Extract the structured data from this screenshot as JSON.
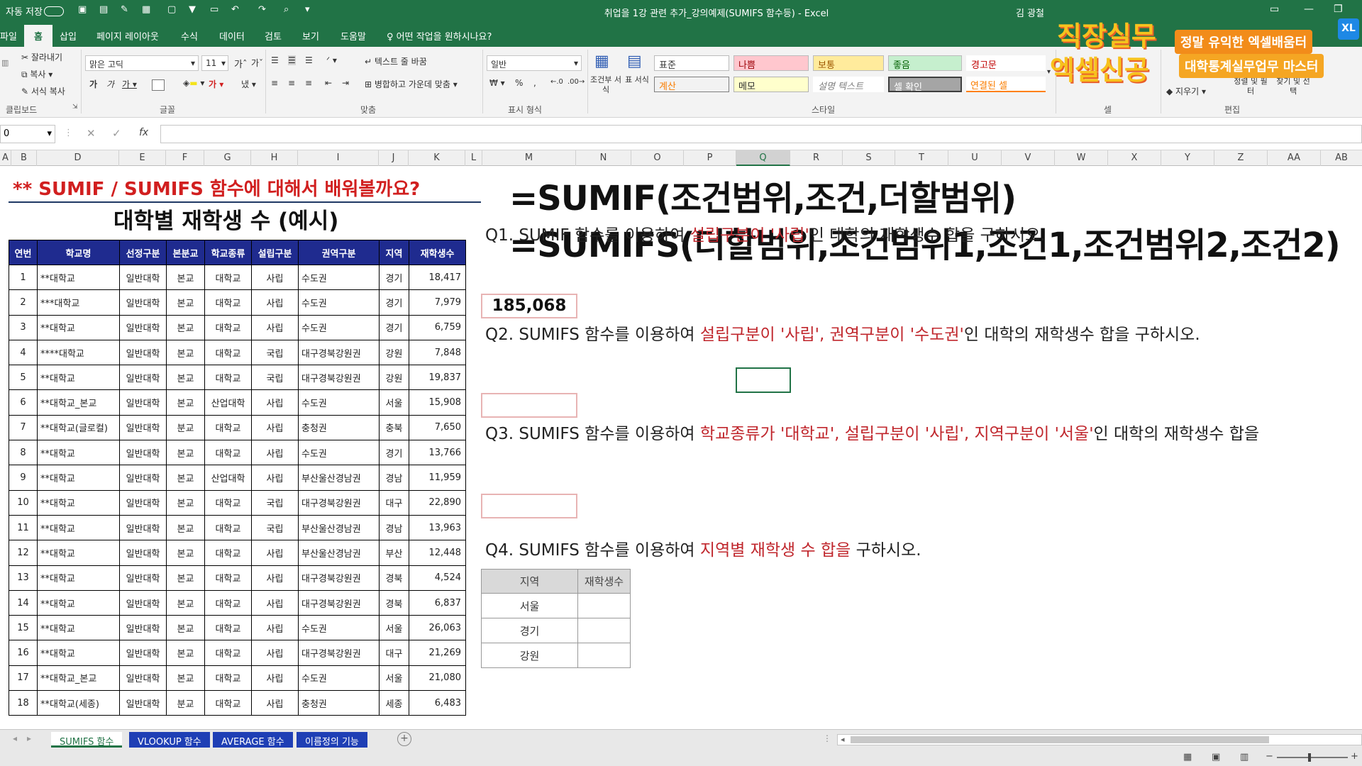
{
  "window": {
    "title": "취업을 1강 관련 추가_강의예제(SUMIFS 함수등) - Excel",
    "user": "김 광철",
    "autosave": "자동 저장"
  },
  "ribbon": {
    "tabs": [
      "파일",
      "홈",
      "삽입",
      "페이지 레이아웃",
      "수식",
      "데이터",
      "검토",
      "보기",
      "도움말"
    ],
    "active_tab": "홈",
    "tell_me": "어떤 작업을 원하시나요?",
    "clipboard": {
      "cut": "잘라내기",
      "copy": "복사",
      "format_painter": "서식 복사",
      "group": "클립보드"
    },
    "font": {
      "name": "맑은 고딕",
      "size": "11",
      "group": "글꼴"
    },
    "align": {
      "wrap": "텍스트 줄 바꿈",
      "merge": "병합하고 가운데 맞춤",
      "group": "맞춤"
    },
    "number": {
      "format": "일반",
      "group": "표시 형식"
    },
    "cond_format": "조건부 서식",
    "table_format": "표 서식",
    "styles": {
      "group": "스타일",
      "items": [
        "표준",
        "나쁨",
        "보통",
        "좋음",
        "경고문",
        "계산",
        "메모",
        "설명 텍스트",
        "셀 확인",
        "연결된 셀"
      ]
    },
    "cells_group": "셀",
    "editing": {
      "clear": "지우기",
      "sort": "정렬 및 필터",
      "find": "찾기 및 선택",
      "group": "편집"
    }
  },
  "formula_bar": {
    "name_box": "0",
    "fx": "fx"
  },
  "columns": [
    "A",
    "B",
    "D",
    "E",
    "F",
    "G",
    "H",
    "I",
    "J",
    "K",
    "L",
    "M",
    "N",
    "O",
    "P",
    "Q",
    "R",
    "S",
    "T",
    "U",
    "V",
    "W",
    "X",
    "Y",
    "Z",
    "AA",
    "AB"
  ],
  "logo": {
    "line1": "직장실무",
    "line2": "엑셀신공",
    "tag1": "정말 유익한 엑셀배움터",
    "tag2": "대학통계실무업무 마스터",
    "badge": "XL"
  },
  "sheet": {
    "heading": "** SUMIF / SUMIFS 함수에 대해서 배워볼까요?",
    "subtitle": "대학별 재학생 수 (예시)",
    "formula1": "=SUMIF(조건범위,조건,더할범위)",
    "formula2": "=SUMIFS(더할범위,조건범위1,조건1,조건범위2,조건2)",
    "table_headers": [
      "연번",
      "학교명",
      "선정구분",
      "본분교",
      "학교종류",
      "설립구분",
      "권역구분",
      "지역",
      "재학생수"
    ],
    "rows": [
      [
        "1",
        "**대학교",
        "일반대학",
        "본교",
        "대학교",
        "사립",
        "수도권",
        "경기",
        "18,417"
      ],
      [
        "2",
        "***대학교",
        "일반대학",
        "본교",
        "대학교",
        "사립",
        "수도권",
        "경기",
        "7,979"
      ],
      [
        "3",
        "**대학교",
        "일반대학",
        "본교",
        "대학교",
        "사립",
        "수도권",
        "경기",
        "6,759"
      ],
      [
        "4",
        "****대학교",
        "일반대학",
        "본교",
        "대학교",
        "국립",
        "대구경북강원권",
        "강원",
        "7,848"
      ],
      [
        "5",
        "**대학교",
        "일반대학",
        "본교",
        "대학교",
        "국립",
        "대구경북강원권",
        "강원",
        "19,837"
      ],
      [
        "6",
        "**대학교_본교",
        "일반대학",
        "본교",
        "산업대학",
        "사립",
        "수도권",
        "서울",
        "15,908"
      ],
      [
        "7",
        "**대학교(글로컬)",
        "일반대학",
        "분교",
        "대학교",
        "사립",
        "충청권",
        "충북",
        "7,650"
      ],
      [
        "8",
        "**대학교",
        "일반대학",
        "본교",
        "대학교",
        "사립",
        "수도권",
        "경기",
        "13,766"
      ],
      [
        "9",
        "**대학교",
        "일반대학",
        "본교",
        "산업대학",
        "사립",
        "부산울산경남권",
        "경남",
        "11,959"
      ],
      [
        "10",
        "**대학교",
        "일반대학",
        "본교",
        "대학교",
        "국립",
        "대구경북강원권",
        "대구",
        "22,890"
      ],
      [
        "11",
        "**대학교",
        "일반대학",
        "본교",
        "대학교",
        "국립",
        "부산울산경남권",
        "경남",
        "13,963"
      ],
      [
        "12",
        "**대학교",
        "일반대학",
        "본교",
        "대학교",
        "사립",
        "부산울산경남권",
        "부산",
        "12,448"
      ],
      [
        "13",
        "**대학교",
        "일반대학",
        "본교",
        "대학교",
        "사립",
        "대구경북강원권",
        "경북",
        "4,524"
      ],
      [
        "14",
        "**대학교",
        "일반대학",
        "본교",
        "대학교",
        "사립",
        "대구경북강원권",
        "경북",
        "6,837"
      ],
      [
        "15",
        "**대학교",
        "일반대학",
        "본교",
        "대학교",
        "사립",
        "수도권",
        "서울",
        "26,063"
      ],
      [
        "16",
        "**대학교",
        "일반대학",
        "본교",
        "대학교",
        "사립",
        "대구경북강원권",
        "대구",
        "21,269"
      ],
      [
        "17",
        "**대학교_본교",
        "일반대학",
        "본교",
        "대학교",
        "사립",
        "수도권",
        "서울",
        "21,080"
      ],
      [
        "18",
        "**대학교(세종)",
        "일반대학",
        "분교",
        "대학교",
        "사립",
        "충청권",
        "세종",
        "6,483"
      ]
    ],
    "q1": {
      "pre": "Q1. SUMIF 함수를 이용하여 ",
      "red": "설립구분이 '사립'",
      "post": "인 대학의 재학생수 합을 구하시오.",
      "answer": "185,068"
    },
    "q2": {
      "pre": "Q2. SUMIFS 함수를 이용하여 ",
      "red": "설립구분이 '사립', 권역구분이 '수도권'",
      "post": "인 대학의 재학생수 합을 구하시오.",
      "answer": ""
    },
    "q3": {
      "pre": "Q3. SUMIFS 함수를 이용하여 ",
      "red": "학교종류가 '대학교', 설립구분이 '사립', 지역구분이 '서울'",
      "post": "인  대학의 재학생수 합을",
      "answer": ""
    },
    "q4": {
      "pre": "Q4. SUMIFS 함수를 이용하여 ",
      "red": "지역별 재학생 수 합을",
      "post": " 구하시오.",
      "headers": [
        "지역",
        "재학생수"
      ],
      "rows": [
        "서울",
        "경기",
        "강원"
      ]
    }
  },
  "sheet_tabs": [
    "SUMIFS 함수",
    "VLOOKUP 함수",
    "AVERAGE 함수",
    "이름정의 기능"
  ],
  "active_sheet": "SUMIFS 함수"
}
